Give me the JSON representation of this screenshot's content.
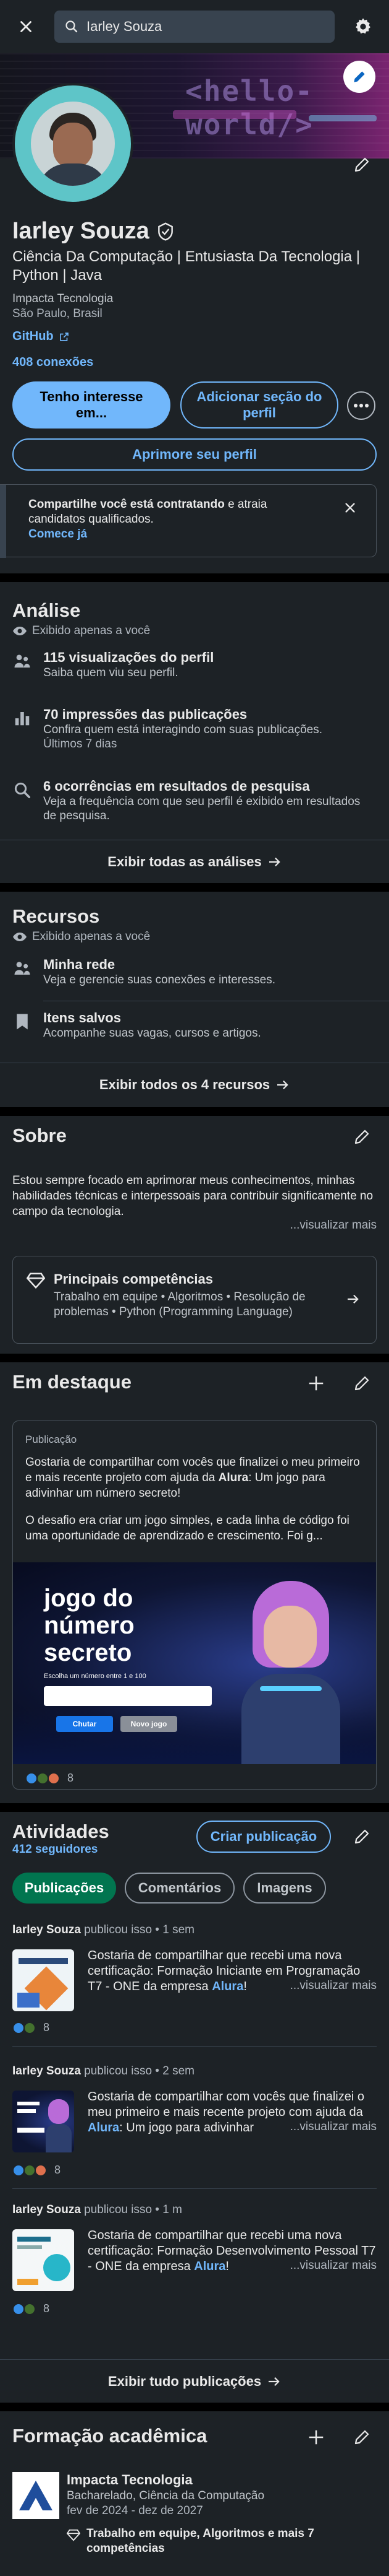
{
  "search": {
    "value": "Iarley Souza"
  },
  "cover": {
    "text": "<hello-world/>"
  },
  "profile": {
    "name": "Iarley Souza",
    "headline": "Ciência Da Computação | Entusiasta Da Tecnologia | Python | Java",
    "company": "Impacta Tecnologia",
    "location": "São Paulo, Brasil",
    "link": "GitHub",
    "connections": "408 conexões",
    "btn_interest": "Tenho interesse em...",
    "btn_add_section": "Adicionar seção do perfil",
    "btn_improve": "Aprimore seu perfil"
  },
  "notice": {
    "text": "Compartilhe você está contratando",
    "text2": " e atraia candidatos qualificados.",
    "link": "Comece já"
  },
  "analysis": {
    "title": "Análise",
    "visibility": "Exibido apenas a você",
    "items": [
      {
        "title": "115 visualizações do perfil",
        "desc": "Saiba quem viu seu perfil."
      },
      {
        "title": "70 impressões das publicações",
        "desc": "Confira quem está interagindo com suas publicações.",
        "desc2": "Últimos 7 dias"
      },
      {
        "title": "6 ocorrências em resultados de pesquisa",
        "desc": "Veja a frequência com que seu perfil é exibido em resultados de pesquisa."
      }
    ],
    "footer": "Exibir todas as análises"
  },
  "resources": {
    "title": "Recursos",
    "visibility": "Exibido apenas a você",
    "items": [
      {
        "title": "Minha rede",
        "desc": "Veja e gerencie suas conexões e interesses."
      },
      {
        "title": "Itens salvos",
        "desc": "Acompanhe suas vagas, cursos e artigos."
      }
    ],
    "footer": "Exibir todos os 4 recursos"
  },
  "about": {
    "title": "Sobre",
    "text": "Estou sempre focado em aprimorar meus conhecimentos, minhas habilidades técnicas e interpessoais para contribuir significamente no campo da tecnologia.",
    "more": "...visualizar mais",
    "skills_title": "Principais competências",
    "skills": "Trabalho em equipe • Algoritmos • Resolução de problemas • Python (Programming Language)"
  },
  "featured": {
    "title": "Em destaque",
    "label": "Publicação",
    "text1": "Gostaria de compartilhar com vocês que finalizei o meu primeiro e mais recente projeto com ajuda da ",
    "brand": "Alura",
    "text1b": ": Um jogo para adivinhar um número secreto!",
    "text2": "O desafio era criar um jogo simples, e cada linha de código foi uma oportunidade de aprendizado e crescimento. Foi g...",
    "game_title": "jogo do número secreto",
    "game_prompt": "Escolha um número entre 1 e 100",
    "game_btn1": "Chutar",
    "game_btn2": "Novo jogo",
    "reactions": "8"
  },
  "activity": {
    "title": "Atividades",
    "followers": "412 seguidores",
    "btn_create": "Criar publicação",
    "tabs": [
      "Publicações",
      "Comentários",
      "Imagens"
    ],
    "posts": [
      {
        "author": "Iarley Souza",
        "meta": " publicou isso • 1 sem",
        "text": "Gostaria de compartilhar que recebi uma nova certificação: Formação Iniciante em Programação T7 - ONE da empresa ",
        "brand": "Alura",
        "tail": "!",
        "more": "...visualizar mais",
        "reactions": "8"
      },
      {
        "author": "Iarley Souza",
        "meta": " publicou isso • 2 sem",
        "text": "Gostaria de compartilhar com vocês que finalizei o meu primeiro e mais recente projeto com ajuda da ",
        "brand": "Alura",
        "tail": ": Um jogo para adivinhar",
        "more": "...visualizar mais",
        "reactions": "8"
      },
      {
        "author": "Iarley Souza",
        "meta": " publicou isso • 1 m",
        "text": "Gostaria de compartilhar que recebi uma nova certificação: Formação Desenvolvimento Pessoal T7 - ONE da empresa ",
        "brand": "Alura",
        "tail": "!",
        "more": "...visualizar mais",
        "reactions": "8"
      }
    ],
    "footer": "Exibir tudo publicações"
  },
  "education": {
    "title": "Formação acadêmica",
    "school": "Impacta Tecnologia",
    "degree": "Bacharelado, Ciência da Computação",
    "dates": "fev de 2024 - dez de 2027",
    "skills": "Trabalho em equipe, Algoritmos e mais 7 competências"
  },
  "colors": {
    "accent": "#71b7fb",
    "card": "#1d2226",
    "bg": "#000000",
    "border": "#38434f"
  },
  "icons": [
    "menu-icon",
    "search-icon",
    "gear-icon",
    "pencil-icon",
    "verified-icon",
    "external-link-icon",
    "more-icon",
    "close-icon",
    "eye-icon",
    "people-icon",
    "bar-chart-icon",
    "search-icon",
    "bookmark-icon",
    "diamond-icon",
    "arrow-right-icon",
    "plus-icon"
  ]
}
